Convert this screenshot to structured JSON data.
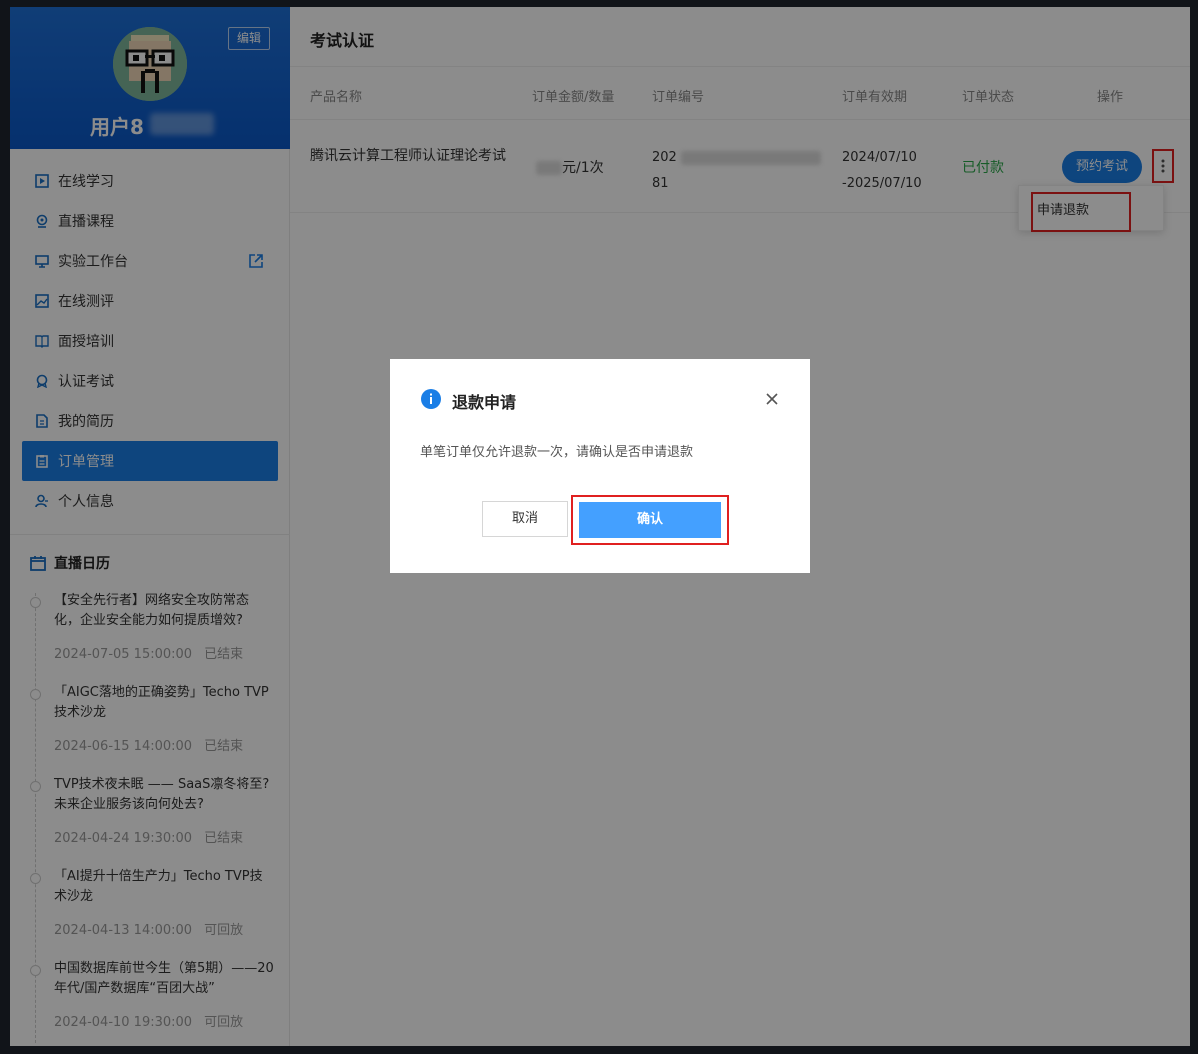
{
  "colors": {
    "accent": "#1a7ee6",
    "paid": "#2aa84a",
    "highlight": "#e02020",
    "confirm": "#44a0ff"
  },
  "profile": {
    "edit_label": "编辑",
    "username": "用户8"
  },
  "sidebar": {
    "items": [
      {
        "label": "在线学习",
        "icon": "play-square-icon"
      },
      {
        "label": "直播课程",
        "icon": "live-pin-icon"
      },
      {
        "label": "实验工作台",
        "icon": "monitor-icon",
        "external": true
      },
      {
        "label": "在线测评",
        "icon": "image-chart-icon"
      },
      {
        "label": "面授培训",
        "icon": "book-open-icon"
      },
      {
        "label": "认证考试",
        "icon": "badge-icon"
      },
      {
        "label": "我的简历",
        "icon": "document-icon"
      },
      {
        "label": "订单管理",
        "icon": "clipboard-icon",
        "active": true
      },
      {
        "label": "个人信息",
        "icon": "user-icon"
      }
    ],
    "calendar": {
      "title": "直播日历",
      "events": [
        {
          "title": "【安全先行者】网络安全攻防常态化，企业安全能力如何提质增效?",
          "time": "2024-07-05 15:00:00",
          "status": "已结束"
        },
        {
          "title": "「AIGC落地的正确姿势」Techo TVP技术沙龙",
          "time": "2024-06-15 14:00:00",
          "status": "已结束"
        },
        {
          "title": "TVP技术夜未眠 —— SaaS凛冬将至? 未来企业服务该向何处去?",
          "time": "2024-04-24 19:30:00",
          "status": "已结束"
        },
        {
          "title": "「AI提升十倍生产力」Techo TVP技术沙龙",
          "time": "2024-04-13 14:00:00",
          "status": "可回放"
        },
        {
          "title": "中国数据库前世今生（第5期）——20年代/国产数据库“百团大战”",
          "time": "2024-04-10 19:30:00",
          "status": "可回放"
        }
      ]
    }
  },
  "main": {
    "title": "考试认证",
    "columns": {
      "product": "产品名称",
      "amount": "订单金额/数量",
      "order_no": "订单编号",
      "validity": "订单有效期",
      "status": "订单状态",
      "action": "操作"
    },
    "row": {
      "product": "腾讯云计算工程师认证理论考试",
      "amount_suffix": "元/1次",
      "order_no_line1": "202",
      "order_no_line2": "81",
      "valid_from": "2024/07/10",
      "valid_to": "-2025/07/10",
      "status": "已付款",
      "book_label": "预约考试"
    },
    "dropdown": {
      "refund_label": "申请退款"
    }
  },
  "modal": {
    "title": "退款申请",
    "message": "单笔订单仅允许退款一次，请确认是否申请退款",
    "cancel_label": "取消",
    "confirm_label": "确认"
  }
}
